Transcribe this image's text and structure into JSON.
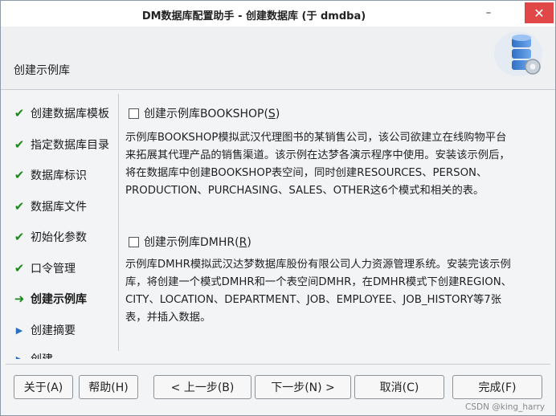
{
  "window": {
    "title": "DM数据库配置助手 - 创建数据库 (于 dmdba)",
    "minimize_glyph": "–",
    "close_glyph": "✕"
  },
  "header": {
    "title": "创建示例库",
    "icon": "database-icon"
  },
  "steps": [
    {
      "label": "创建数据库模板",
      "state": "done"
    },
    {
      "label": "指定数据库目录",
      "state": "done"
    },
    {
      "label": "数据库标识",
      "state": "done"
    },
    {
      "label": "数据库文件",
      "state": "done"
    },
    {
      "label": "初始化参数",
      "state": "done"
    },
    {
      "label": "口令管理",
      "state": "done"
    },
    {
      "label": "创建示例库",
      "state": "current"
    },
    {
      "label": "创建摘要",
      "state": "pending"
    },
    {
      "label": "创建",
      "state": "pending"
    }
  ],
  "bookshop": {
    "checkbox_label_prefix": "创建示例库BOOKSHOP(",
    "checkbox_mnemonic": "S",
    "checkbox_label_suffix": ")",
    "checked": false,
    "lines": [
      "示例库BOOKSHOP模拟武汉代理图书的某销售公司，该公司欲建立在线购物平台",
      "来拓展其代理产品的销售渠道。该示例在达梦各演示程序中使用。安装该示例后，",
      "将在数据库中创建BOOKSHOP表空间，同时创建RESOURCES、PERSON、",
      "PRODUCTION、PURCHASING、SALES、OTHER这6个模式和相关的表。"
    ]
  },
  "dmhr": {
    "checkbox_label_prefix": "创建示例库DMHR(",
    "checkbox_mnemonic": "R",
    "checkbox_label_suffix": ")",
    "checked": false,
    "lines": [
      "示例库DMHR模拟武汉达梦数据库股份有限公司人力资源管理系统。安装完该示例",
      "库，将创建一个模式DMHR和一个表空间DMHR，在DMHR模式下创建REGION、",
      "CITY、LOCATION、DEPARTMENT、JOB、EMPLOYEE、JOB_HISTORY等7张",
      "表，并插入数据。"
    ]
  },
  "buttons": {
    "about": "关于(A)",
    "help": "帮助(H)",
    "back": "< 上一步(B)",
    "next": "下一步(N) >",
    "cancel": "取消(C)",
    "finish": "完成(F)"
  },
  "watermark": "CSDN @king_harry",
  "colors": {
    "check_green": "#1b8a1b",
    "pending_blue": "#2a6fc0",
    "close_red": "#e04848"
  }
}
